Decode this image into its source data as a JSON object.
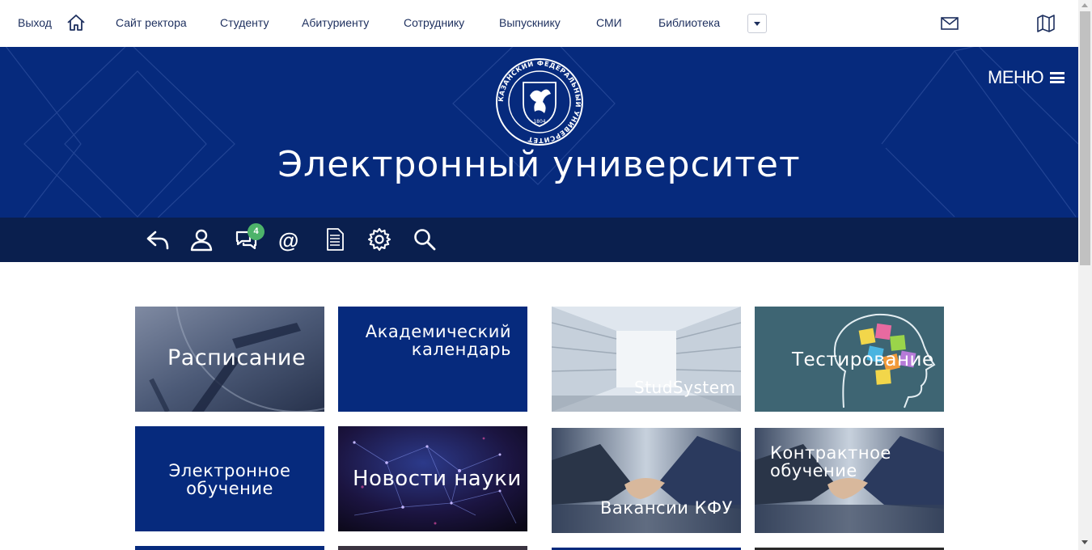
{
  "topnav": {
    "logout": "Выход",
    "links": [
      "Сайт ректора",
      "Студенту",
      "Абитуриенту",
      "Сотруднику",
      "Выпускнику",
      "СМИ",
      "Библиотека"
    ],
    "icons": {
      "home": "home-icon",
      "more": "chevron-down-icon",
      "mail": "mail-icon",
      "map": "map-icon"
    }
  },
  "hero": {
    "logo_ring_text": "КАЗАНСКИЙ ФЕДЕРАЛЬНЫЙ УНИВЕРСИТЕТ",
    "logo_year": "1804",
    "title": "Электронный университет",
    "menu_label": "МЕНЮ"
  },
  "toolbar": {
    "messages_count": "4",
    "at_symbol": "@",
    "icons": [
      "reply-icon",
      "user-icon",
      "messages-icon",
      "at-icon",
      "document-icon",
      "settings-icon",
      "search-icon"
    ]
  },
  "tiles": [
    {
      "label": "Расписание"
    },
    {
      "label_line1": "Академический",
      "label_line2": "календарь"
    },
    {
      "label": "StudSystem"
    },
    {
      "label": "Тестирование"
    },
    {
      "label_line1": "Электронное",
      "label_line2": "обучение"
    },
    {
      "label": "Новости науки"
    },
    {
      "label": "Вакансии КФУ"
    },
    {
      "label_line1": "Контрактное",
      "label_line2": "обучение"
    }
  ],
  "colors": {
    "brand_blue": "#062a7d",
    "toolbar_navy": "#0a1f4e",
    "nav_text": "#1d2f5e",
    "badge_green": "#4db36a"
  }
}
